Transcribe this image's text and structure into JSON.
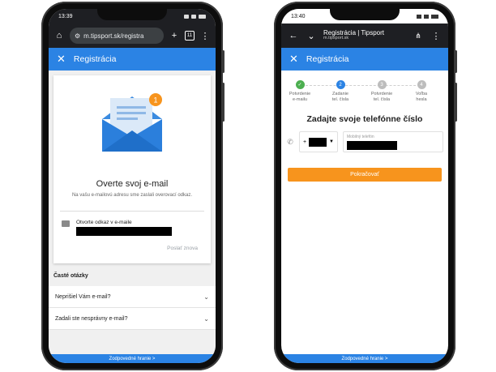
{
  "left_phone": {
    "status": {
      "time": "13:39"
    },
    "browser": {
      "url": "m.tipsport.sk/registra",
      "tab_count": "11"
    },
    "appbar": {
      "title": "Registrácia"
    },
    "card": {
      "badge": "1",
      "title": "Overte svoj e-mail",
      "subtitle": "Na vašu e-mailovú adresu sme zaslali overovací odkaz.",
      "mail_label": "Otvorte odkaz v e-maile",
      "resend": "Poslať znova"
    },
    "faq": {
      "heading": "Časté otázky",
      "items": [
        "Neprišiel Vám e-mail?",
        "Zadali ste nesprávny e-mail?"
      ]
    },
    "footer": "Zodpovedné hranie >"
  },
  "right_phone": {
    "status": {
      "time": "13:40"
    },
    "browser": {
      "title": "Registrácia | Tipsport",
      "domain": "m.tipsport.sk"
    },
    "appbar": {
      "title": "Registrácia"
    },
    "steps": [
      {
        "num": "✓",
        "line1": "Potvrdenie",
        "line2": "e-mailu",
        "state": "done"
      },
      {
        "num": "2",
        "line1": "Zadanie",
        "line2": "tel. čísla",
        "state": "active"
      },
      {
        "num": "3",
        "line1": "Potvrdenie",
        "line2": "tel. čísla",
        "state": "todo"
      },
      {
        "num": "4",
        "line1": "Voľba",
        "line2": "hesla",
        "state": "todo"
      }
    ],
    "form": {
      "title": "Zadajte svoje telefónne číslo",
      "prefix_sign": "+",
      "number_label": "Mobilný telefón",
      "continue_label": "Pokračovať"
    },
    "footer": "Zodpovedné hranie >"
  },
  "colors": {
    "primary": "#2b83e4",
    "accent": "#f7941d",
    "success": "#4caf50",
    "step_todo": "#bdbdbd"
  }
}
